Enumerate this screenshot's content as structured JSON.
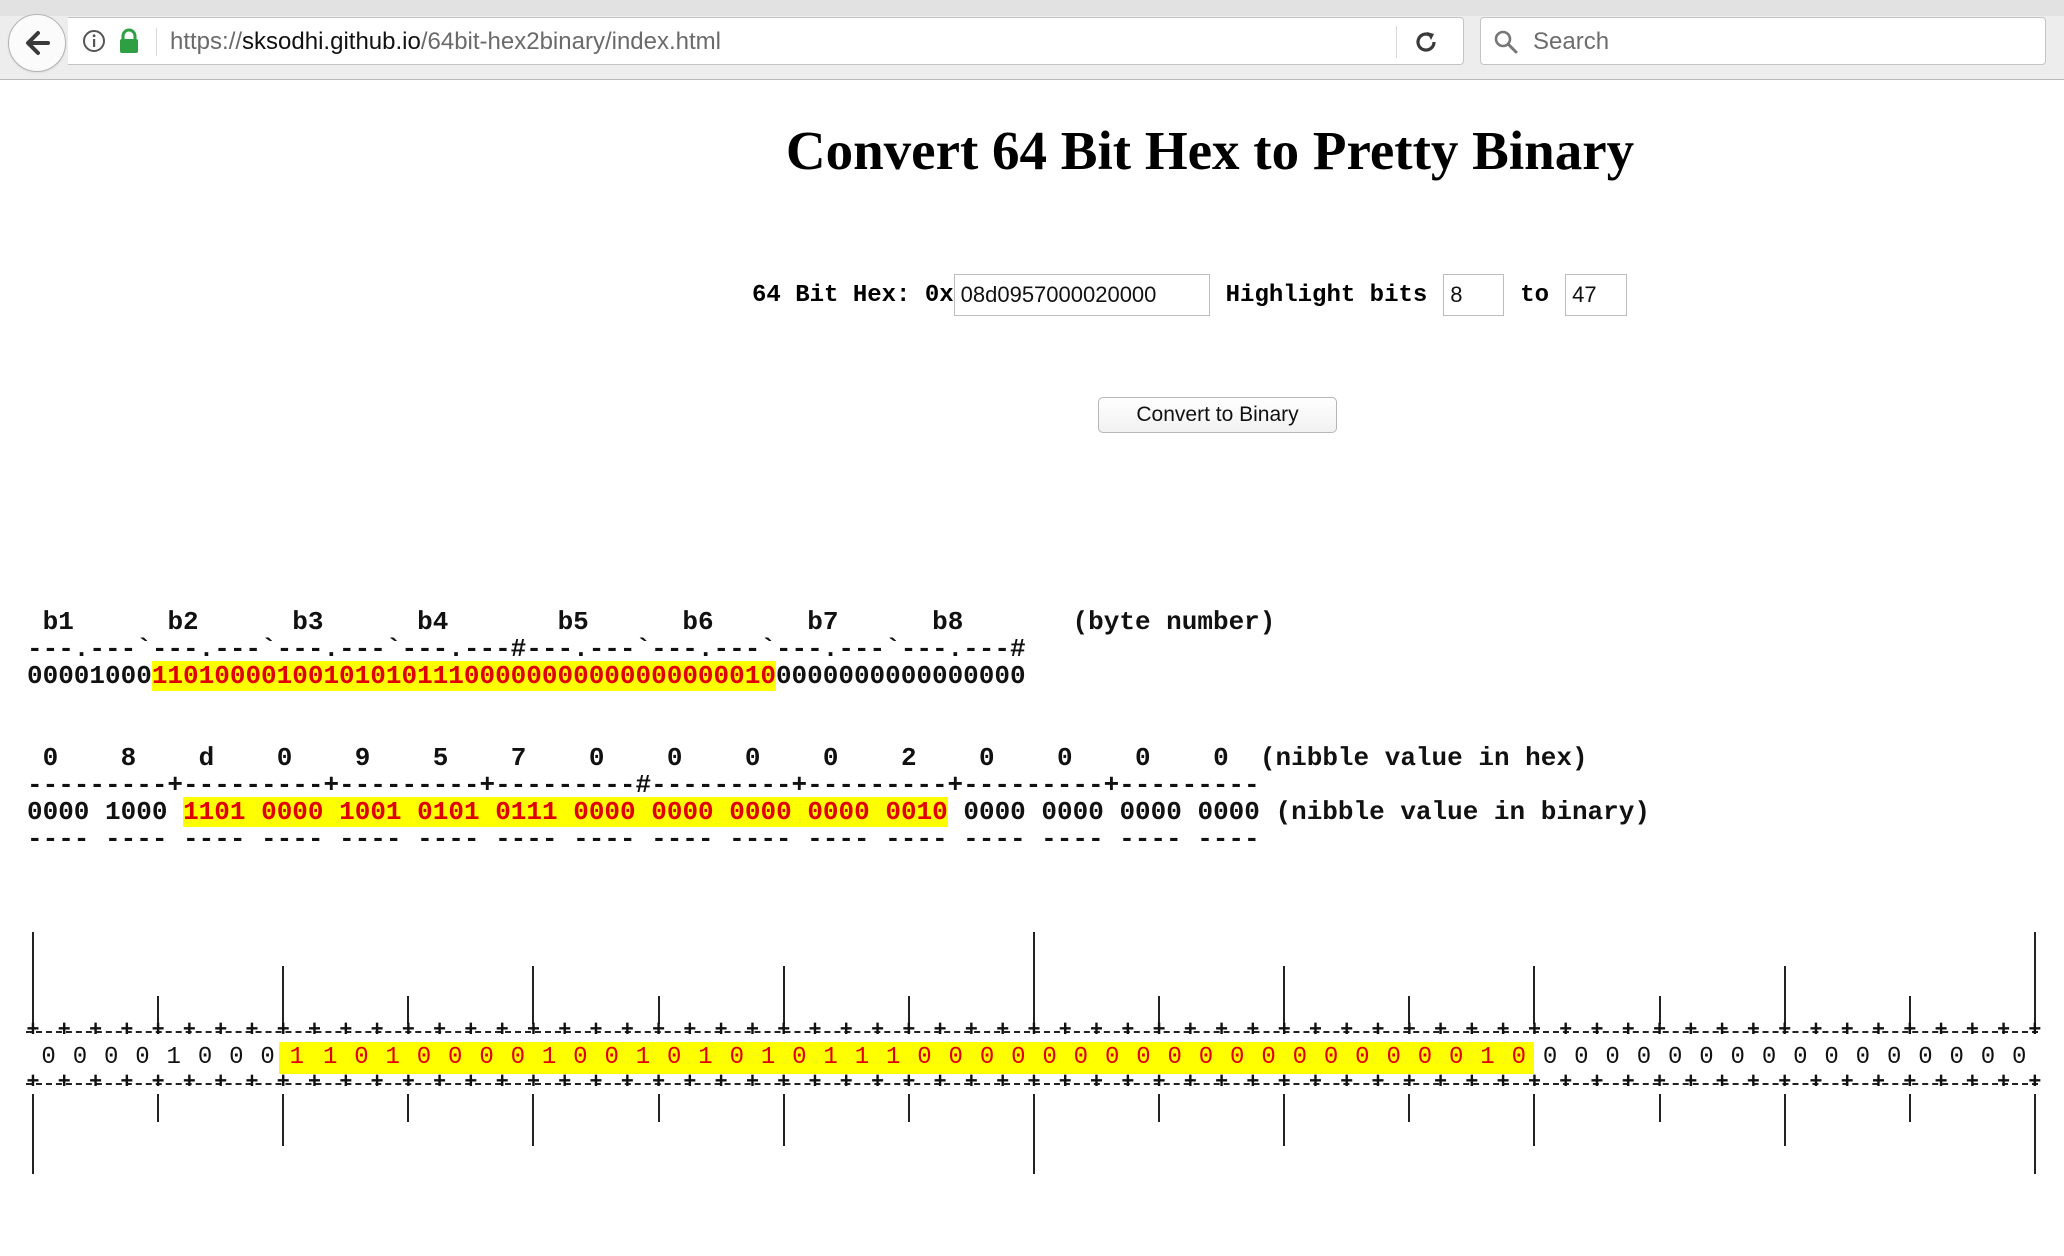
{
  "browser": {
    "url_prefix": "https://",
    "url_host": "sksodhi.github.io",
    "url_path": "/64bit-hex2binary/index.html",
    "search_placeholder": "Search",
    "icons": [
      "back-arrow-icon",
      "info-icon",
      "lock-icon",
      "reload-icon",
      "search-icon"
    ],
    "lock_color": "#2ea043"
  },
  "page": {
    "title": "Convert 64 Bit Hex to Pretty Binary",
    "form": {
      "hex_label": "64 Bit Hex: 0x",
      "hex_value": "08d0957000020000",
      "highlight_label": "Highlight bits",
      "highlight_from": "8",
      "to_label": "to",
      "highlight_to": "47"
    },
    "convert_button_label": "Convert to Binary",
    "highlight_colors": {
      "background": "#ffff00",
      "text": "#e00000"
    },
    "byte_section": {
      "byte_labels": [
        "b1",
        "b2",
        "b3",
        "b4",
        "b5",
        "b6",
        "b7",
        "b8"
      ],
      "byte_caption": "(byte number)",
      "separator": "---.---`---.---`---.---`---.---#---.---`---.---`---.---`---.---#",
      "bits_before": "00001000",
      "bits_highlight": "1101000010010101011100000000000000000010",
      "bits_after": "0000000000000000"
    },
    "nibble_section": {
      "hex_nibbles": [
        "0",
        "8",
        "d",
        "0",
        "9",
        "5",
        "7",
        "0",
        "0",
        "0",
        "0",
        "2",
        "0",
        "0",
        "0",
        "0"
      ],
      "hex_caption": "(nibble value in hex)",
      "separator": "---------+---------+---------+---------#---------+---------+---------+---------",
      "binary_before": [
        "0000",
        "1000"
      ],
      "binary_highlight": [
        "1101",
        "0000",
        "1001",
        "0101",
        "0111",
        "0000",
        "0000",
        "0000",
        "0000",
        "0010"
      ],
      "binary_after": [
        "0000",
        "0000",
        "0000",
        "0000"
      ],
      "binary_caption": "(nibble value in binary)",
      "underline": "---- ---- ---- ---- ---- ---- ---- ---- ---- ---- ---- ---- ---- ---- ---- ----"
    },
    "bit_ruler": {
      "bits": "0000100011010000100101010111000000000000000000100000000000000000",
      "highlight_from": 8,
      "highlight_to": 47
    }
  }
}
